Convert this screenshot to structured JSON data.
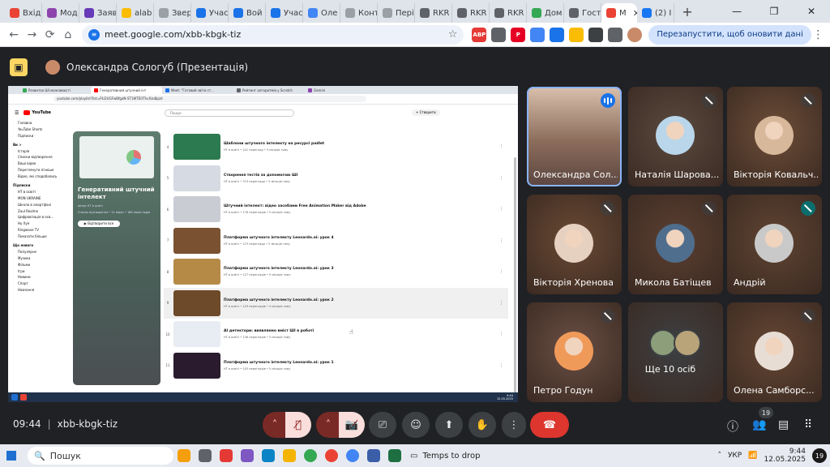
{
  "browser": {
    "tabs": [
      {
        "label": "Вхід",
        "color": "#ea4335"
      },
      {
        "label": "Мод",
        "color": "#8e44ad"
      },
      {
        "label": "Заяв",
        "color": "#673ab7"
      },
      {
        "label": "alab",
        "color": "#fbbc04"
      },
      {
        "label": "Звер",
        "color": "#9aa0a6"
      },
      {
        "label": "Учас",
        "color": "#1a73e8"
      },
      {
        "label": "Вой",
        "color": "#1a73e8"
      },
      {
        "label": "Учас",
        "color": "#1a73e8"
      },
      {
        "label": "Оле",
        "color": "#4285f4"
      },
      {
        "label": "Конт",
        "color": "#9aa0a6"
      },
      {
        "label": "Пері",
        "color": "#9aa0a6"
      },
      {
        "label": "RKR",
        "color": "#5f6368"
      },
      {
        "label": "RKR",
        "color": "#5f6368"
      },
      {
        "label": "RKR",
        "color": "#5f6368"
      },
      {
        "label": "Дом",
        "color": "#34a853"
      },
      {
        "label": "Гост",
        "color": "#5f6368"
      },
      {
        "label": "М",
        "color": "#ea4335"
      },
      {
        "label": "(2) I",
        "color": "#1877f2"
      }
    ],
    "new_tab": "+",
    "url": "meet.google.com/xbb-kbgk-tiz",
    "relaunch_label": "Перезапустити, щоб оновити дані",
    "extensions": [
      {
        "label": "ABP",
        "color": "#e53935"
      },
      {
        "label": "",
        "color": "#5f6368"
      },
      {
        "label": "P",
        "color": "#e60023"
      },
      {
        "label": "",
        "color": "#4285f4"
      },
      {
        "label": "",
        "color": "#1a73e8"
      },
      {
        "label": "",
        "color": "#fbbc04"
      },
      {
        "label": "",
        "color": "#3c4043"
      },
      {
        "label": "",
        "color": "#5f6368"
      }
    ]
  },
  "meet": {
    "presenter": "Олександра Сологуб (Презентація)",
    "time": "09:44",
    "separator": "|",
    "code": "xbb-kbgk-tiz",
    "participants_count": "19",
    "participants": [
      {
        "name": "Олександра Сол...",
        "speaking": true,
        "bg": "#7b6a5e",
        "avatar": "#e0b49a"
      },
      {
        "name": "Наталія Шарова...",
        "speaking": false,
        "bg": "#5a4a3f",
        "avatar": "#b9d6ea"
      },
      {
        "name": "Вікторія Ковальч...",
        "speaking": false,
        "bg": "#6e4e38",
        "avatar": "#d8b89a"
      },
      {
        "name": "Вікторія Хренова",
        "speaking": false,
        "bg": "#6b4a34",
        "avatar": "#e6d1c1"
      },
      {
        "name": "Микола Батіщев",
        "speaking": false,
        "bg": "#5b3f31",
        "avatar": "#4f6e8e"
      },
      {
        "name": "Андрій",
        "speaking": false,
        "bg": "#604432",
        "avatar": "#c9c9c9",
        "speaker_icon": true
      },
      {
        "name": "Петро Годун",
        "speaking": false,
        "bg": "#6a4f44",
        "avatar": "#f09a5a"
      },
      {
        "name": "Ще 10 осіб",
        "speaking": false,
        "bg": "#3c4043",
        "avatar": ""
      },
      {
        "name": "Олена Самборс...",
        "speaking": false,
        "bg": "#664733",
        "avatar": "#e8ddd5"
      }
    ]
  },
  "shared_screen": {
    "url": "youtube.com/playlist?list=PLI2UGFwBfgaN-ST1WTEOTkvXzo8pzd",
    "search_placeholder": "Пошук",
    "create_label": "+ Створити",
    "logo": "YouTube",
    "tabs": [
      "Розвиток ШІ можливості",
      "Генеративний штучний інт",
      "Meet: \"Готовий звіти ст...",
      "Рейтинг алгоритмів у Scratch",
      "Gemini"
    ],
    "sidebar": [
      {
        "label": "Головна",
        "header": false
      },
      {
        "label": "YouTube Shorts",
        "header": false
      },
      {
        "label": "Підписки",
        "header": false
      },
      {
        "label": "Ви >",
        "header": true
      },
      {
        "label": "Історія",
        "header": false
      },
      {
        "label": "Списки відтворення",
        "header": false
      },
      {
        "label": "Ваші відео",
        "header": false
      },
      {
        "label": "Переглянути пізніше",
        "header": false
      },
      {
        "label": "Відео, які сподобались",
        "header": false
      },
      {
        "label": "Підписки",
        "header": true
      },
      {
        "label": "НТ в освіті",
        "header": false
      },
      {
        "label": "MON UKRAINE",
        "header": false
      },
      {
        "label": "Школа в смартфоні",
        "header": false
      },
      {
        "label": "Zaul Realme",
        "header": false
      },
      {
        "label": "Цифровізація в осв...",
        "header": false
      },
      {
        "label": "Ну Хуя",
        "header": false
      },
      {
        "label": "Ringwave TV",
        "header": false
      },
      {
        "label": "Показати більше",
        "header": false
      },
      {
        "label": "Що нового",
        "header": true
      },
      {
        "label": "Популярне",
        "header": false
      },
      {
        "label": "Музика",
        "header": false
      },
      {
        "label": "Фільми",
        "header": false
      },
      {
        "label": "Ігри",
        "header": false
      },
      {
        "label": "Новини",
        "header": false
      },
      {
        "label": "Спорт",
        "header": false
      },
      {
        "label": "Навчання",
        "header": false
      }
    ],
    "playlist": {
      "title": "Генеративний штучний інтелект",
      "author": "автор НТ в освіті",
      "meta": "Список відтворення • 11 відео • 186 переглядів",
      "play_label": "▶ Відтворити все"
    },
    "videos": [
      {
        "idx": "4",
        "title": "Шаблони штучного інтелекту на ресурсі padlet",
        "meta": "НТ в освіті • 241 перегляд • 5 місяців тому",
        "color": "#2c7a4f",
        "hl": false
      },
      {
        "idx": "5",
        "title": "Створення тестів за допомогою ШІ",
        "meta": "НТ в освіті • 374 перегляди • 5 місяців тому",
        "color": "#d6dbe3",
        "hl": false
      },
      {
        "idx": "6",
        "title": "Штучний інтелект: відео засобами Free Animation Maker від Adobe",
        "meta": "НТ в освіті • 176 переглядів • 5 місяців тому",
        "color": "#c9ccd3",
        "hl": false
      },
      {
        "idx": "7",
        "title": "Платформа штучного інтелекту Leonardo.ai: урок 4",
        "meta": "НТ в освіті • 273 перегляди • 5 місяців тому",
        "color": "#7a5232",
        "hl": false
      },
      {
        "idx": "8",
        "title": "Платформа штучного інтелекту Leonardo.ai: урок 3",
        "meta": "НТ в освіті • 127 переглядів • 5 місяців тому",
        "color": "#b58a47",
        "hl": false
      },
      {
        "idx": "9",
        "title": "Платформа штучного інтелекту Leonardo.ai: урок 2",
        "meta": "НТ в освіті • 129 переглядів • 5 місяців тому",
        "color": "#6d4a2a",
        "hl": true
      },
      {
        "idx": "10",
        "title": "АІ детектори: виявляємо вміст ШІ в роботі",
        "meta": "НТ в освіті • 136 переглядів • 5 місяців тому",
        "color": "#e8edf3",
        "hl": false
      },
      {
        "idx": "11",
        "title": "Платформа штучного інтелекту Leonardo.ai: урок 1",
        "meta": "НТ в освіті • 105 переглядів • 5 місяців тому",
        "color": "#2a1c2e",
        "hl": false
      }
    ],
    "clock_time": "9:44",
    "clock_date": "12.05.2025"
  },
  "taskbar": {
    "search_label": "Пошук",
    "drop_label": "Temps to drop",
    "lang": "УКР",
    "time": "9:44",
    "date": "12.05.2025",
    "notif_count": "19",
    "apps": [
      {
        "name": "copilot",
        "color": "#f59e0b"
      },
      {
        "name": "taskview",
        "color": "#5f6368"
      },
      {
        "name": "opera",
        "color": "#e53935"
      },
      {
        "name": "copilot-app",
        "color": "#7e57c2"
      },
      {
        "name": "edge",
        "color": "#0a84c6"
      },
      {
        "name": "explorer",
        "color": "#f4b400"
      },
      {
        "name": "chrome-1",
        "color": "#34a853"
      },
      {
        "name": "chrome-2",
        "color": "#ea4335"
      },
      {
        "name": "chrome-3",
        "color": "#4285f4"
      },
      {
        "name": "network",
        "color": "#3b5ea8"
      },
      {
        "name": "excel",
        "color": "#1d6f42"
      }
    ]
  }
}
